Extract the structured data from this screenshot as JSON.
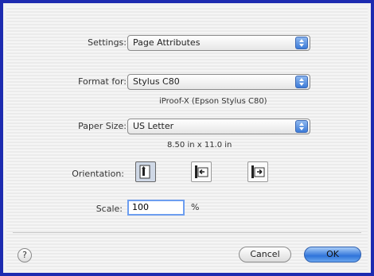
{
  "settings": {
    "label": "Settings:",
    "value": "Page Attributes"
  },
  "format_for": {
    "label": "Format for:",
    "value": "Stylus C80",
    "detail": "iProof-X (Epson Stylus C80)"
  },
  "paper_size": {
    "label": "Paper Size:",
    "value": "US Letter",
    "detail": "8.50 in x 11.0 in"
  },
  "orientation": {
    "label": "Orientation:",
    "options": [
      "portrait",
      "landscape-left",
      "landscape-right"
    ],
    "selected": "portrait"
  },
  "scale": {
    "label": "Scale:",
    "value": "100",
    "unit": "%"
  },
  "buttons": {
    "help": "?",
    "cancel": "Cancel",
    "ok": "OK"
  },
  "colors": {
    "frame": "#1d2bb0",
    "accent": "#3c7bd8"
  }
}
